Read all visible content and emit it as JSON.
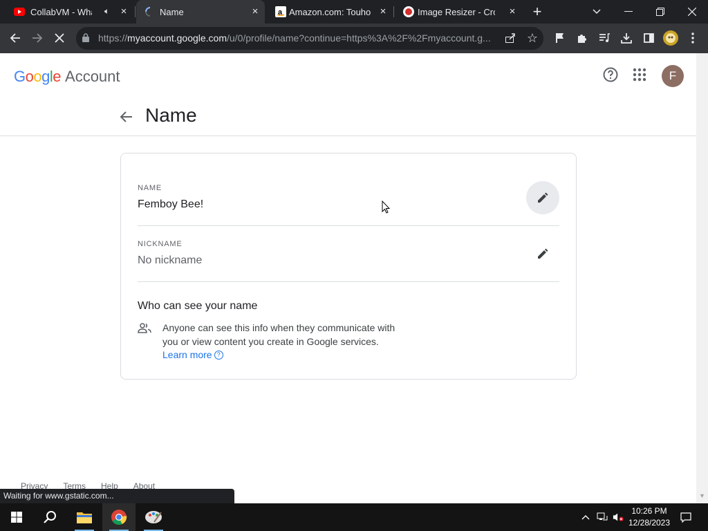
{
  "browser": {
    "tabs": [
      {
        "title": "CollabVM - What",
        "favicon": "youtube-icon",
        "audio": true
      },
      {
        "title": "Name",
        "favicon": "loading-spinner-icon",
        "active": true
      },
      {
        "title": "Amazon.com: Touhou",
        "favicon": "amazon-icon"
      },
      {
        "title": "Image Resizer - Crop &",
        "favicon": "image-resizer-icon"
      }
    ],
    "url_prefix": "https://",
    "url_host": "myaccount.google.com",
    "url_rest": "/u/0/profile/name?continue=https%3A%2F%2Fmyaccount.g...",
    "status_text": "Waiting for www.gstatic.com..."
  },
  "header": {
    "logo_letters": [
      "G",
      "o",
      "o",
      "g",
      "l",
      "e"
    ],
    "logo_colors": [
      "#4285F4",
      "#EA4335",
      "#FBBC05",
      "#4285F4",
      "#34A853",
      "#EA4335"
    ],
    "product": "Account",
    "avatar_initial": "F"
  },
  "page": {
    "title": "Name",
    "name_label": "NAME",
    "name_value": "Femboy Bee!",
    "nickname_label": "NICKNAME",
    "nickname_value": "No nickname",
    "who_title": "Who can see your name",
    "who_text": "Anyone can see this info when they communicate with you or view content you create in Google services.",
    "learn_more": "Learn more",
    "learn_more_glyph": "?"
  },
  "footer": {
    "links": [
      "Privacy",
      "Terms",
      "Help",
      "About"
    ]
  },
  "taskbar": {
    "time": "10:26 PM",
    "date": "12/28/2023"
  },
  "colors": {
    "tabbar": "#202124",
    "toolbar": "#35363a",
    "link": "#1a73e8",
    "avatar": "#8d6e63"
  }
}
